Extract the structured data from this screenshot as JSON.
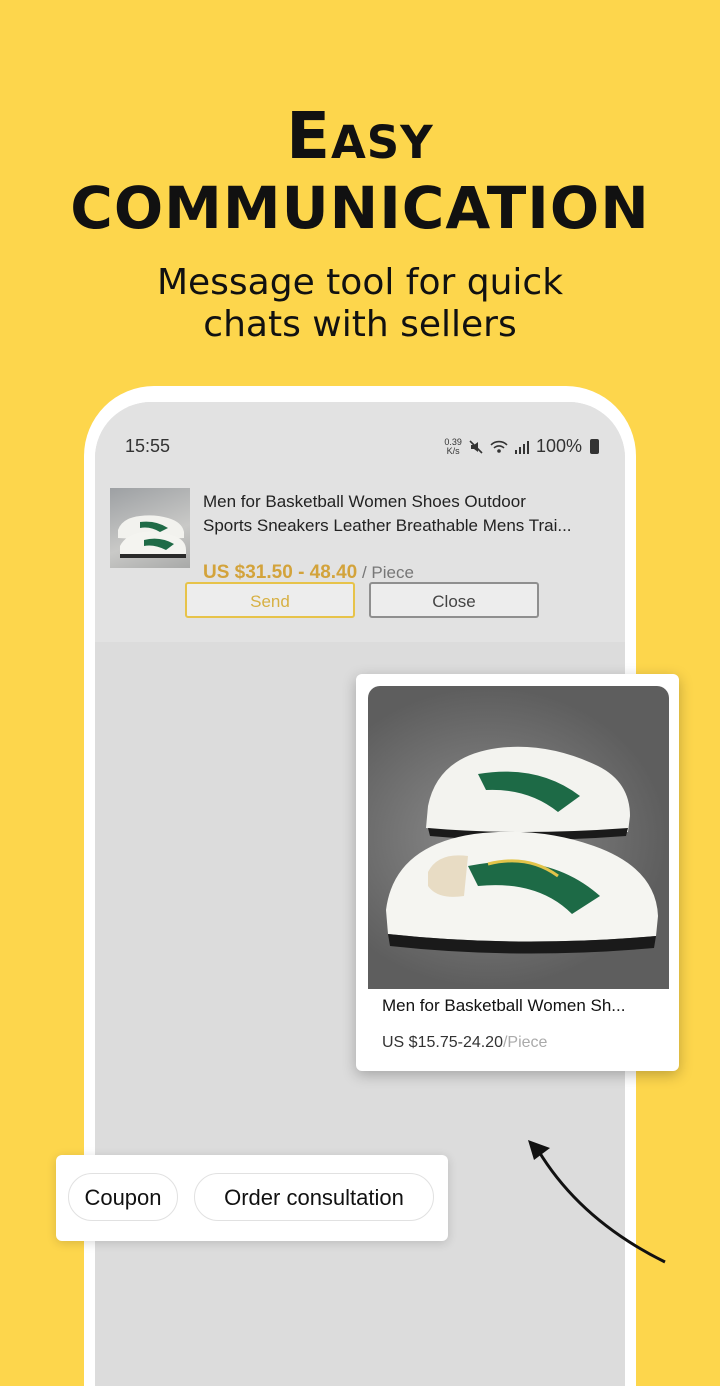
{
  "headline": {
    "line1": "Easy",
    "line2": "COMMUNICATION"
  },
  "subtitle": {
    "line1": "Message tool for quick",
    "line2": "chats with sellers"
  },
  "statusbar": {
    "time": "15:55",
    "speed_value": "0.39",
    "speed_unit": "K/s",
    "battery": "100%"
  },
  "product": {
    "title_line1": "Men for Basketball Women Shoes Outdoor",
    "title_line2": "Sports Sneakers Leather Breathable Mens Trai...",
    "price": "US $31.50 - 48.40",
    "unit": " / Piece",
    "send_label": "Send",
    "close_label": "Close"
  },
  "popup": {
    "title": "Men for Basketball Women Sh...",
    "price": "US $15.75-24.20",
    "unit": "/Piece"
  },
  "chips": {
    "coupon": "Coupon",
    "order": "Order consultation"
  },
  "colors": {
    "background": "#FDD64C",
    "accent": "#D3A33B"
  }
}
